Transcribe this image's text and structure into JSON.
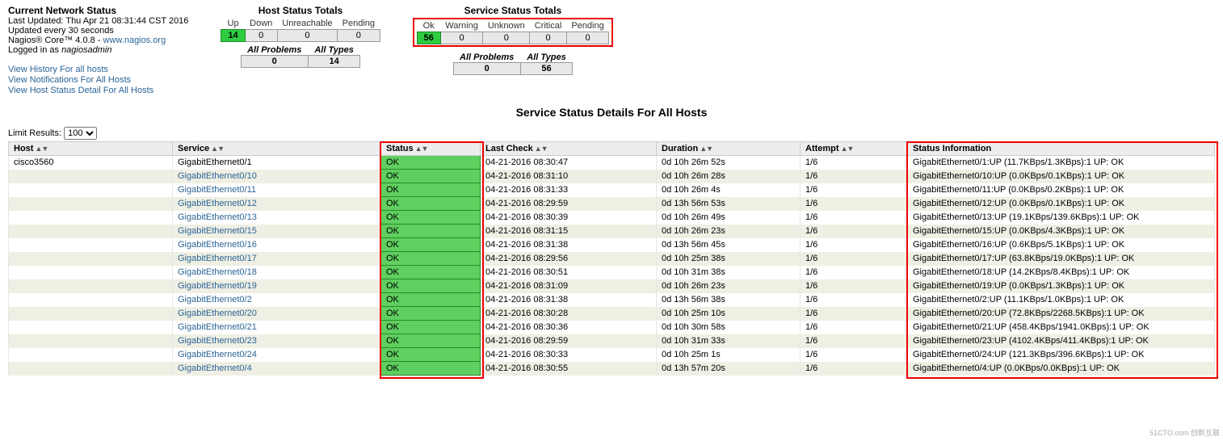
{
  "header": {
    "net_status_title": "Current Network Status",
    "last_updated": "Last Updated: Thu Apr 21 08:31:44 CST 2016",
    "update_interval": "Updated every 30 seconds",
    "product": "Nagios® Core™ 4.0.8 - ",
    "product_link": "www.nagios.org",
    "logged_in_prefix": "Logged in as ",
    "logged_in_user": "nagiosadmin",
    "links": {
      "history": "View History For all hosts",
      "notifications": "View Notifications For All Hosts",
      "host_detail": "View Host Status Detail For All Hosts"
    }
  },
  "host_totals": {
    "title": "Host Status Totals",
    "cols": [
      "Up",
      "Down",
      "Unreachable",
      "Pending"
    ],
    "vals": [
      "14",
      "0",
      "0",
      "0"
    ],
    "problems_label": "All Problems",
    "all_types_label": "All Types",
    "problems_val": "0",
    "all_types_val": "14"
  },
  "service_totals": {
    "title": "Service Status Totals",
    "cols": [
      "Ok",
      "Warning",
      "Unknown",
      "Critical",
      "Pending"
    ],
    "vals": [
      "56",
      "0",
      "0",
      "0",
      "0"
    ],
    "problems_label": "All Problems",
    "all_types_label": "All Types",
    "problems_val": "0",
    "all_types_val": "56"
  },
  "page_title": "Service Status Details For All Hosts",
  "limit": {
    "label": "Limit Results:",
    "value": "100"
  },
  "columns": {
    "host": "Host",
    "service": "Service",
    "status": "Status",
    "last_check": "Last Check",
    "duration": "Duration",
    "attempt": "Attempt",
    "status_info": "Status Information"
  },
  "host_name": "cisco3560",
  "rows": [
    {
      "service": "GigabitEthernet0/1",
      "status": "OK",
      "last_check": "04-21-2016 08:30:47",
      "duration": "0d 10h 26m 52s",
      "attempt": "1/6",
      "info": "GigabitEthernet0/1:UP (11.7KBps/1.3KBps):1 UP: OK",
      "link": false
    },
    {
      "service": "GigabitEthernet0/10",
      "status": "OK",
      "last_check": "04-21-2016 08:31:10",
      "duration": "0d 10h 26m 28s",
      "attempt": "1/6",
      "info": "GigabitEthernet0/10:UP (0.0KBps/0.1KBps):1 UP: OK",
      "link": true
    },
    {
      "service": "GigabitEthernet0/11",
      "status": "OK",
      "last_check": "04-21-2016 08:31:33",
      "duration": "0d 10h 26m 4s",
      "attempt": "1/6",
      "info": "GigabitEthernet0/11:UP (0.0KBps/0.2KBps):1 UP: OK",
      "link": true
    },
    {
      "service": "GigabitEthernet0/12",
      "status": "OK",
      "last_check": "04-21-2016 08:29:59",
      "duration": "0d 13h 56m 53s",
      "attempt": "1/6",
      "info": "GigabitEthernet0/12:UP (0.0KBps/0.1KBps):1 UP: OK",
      "link": true
    },
    {
      "service": "GigabitEthernet0/13",
      "status": "OK",
      "last_check": "04-21-2016 08:30:39",
      "duration": "0d 10h 26m 49s",
      "attempt": "1/6",
      "info": "GigabitEthernet0/13:UP (19.1KBps/139.6KBps):1 UP: OK",
      "link": true
    },
    {
      "service": "GigabitEthernet0/15",
      "status": "OK",
      "last_check": "04-21-2016 08:31:15",
      "duration": "0d 10h 26m 23s",
      "attempt": "1/6",
      "info": "GigabitEthernet0/15:UP (0.0KBps/4.3KBps):1 UP: OK",
      "link": true
    },
    {
      "service": "GigabitEthernet0/16",
      "status": "OK",
      "last_check": "04-21-2016 08:31:38",
      "duration": "0d 13h 56m 45s",
      "attempt": "1/6",
      "info": "GigabitEthernet0/16:UP (0.6KBps/5.1KBps):1 UP: OK",
      "link": true
    },
    {
      "service": "GigabitEthernet0/17",
      "status": "OK",
      "last_check": "04-21-2016 08:29:56",
      "duration": "0d 10h 25m 38s",
      "attempt": "1/6",
      "info": "GigabitEthernet0/17:UP (63.8KBps/19.0KBps):1 UP: OK",
      "link": true
    },
    {
      "service": "GigabitEthernet0/18",
      "status": "OK",
      "last_check": "04-21-2016 08:30:51",
      "duration": "0d 10h 31m 38s",
      "attempt": "1/6",
      "info": "GigabitEthernet0/18:UP (14.2KBps/8.4KBps):1 UP: OK",
      "link": true
    },
    {
      "service": "GigabitEthernet0/19",
      "status": "OK",
      "last_check": "04-21-2016 08:31:09",
      "duration": "0d 10h 26m 23s",
      "attempt": "1/6",
      "info": "GigabitEthernet0/19:UP (0.0KBps/1.3KBps):1 UP: OK",
      "link": true
    },
    {
      "service": "GigabitEthernet0/2",
      "status": "OK",
      "last_check": "04-21-2016 08:31:38",
      "duration": "0d 13h 56m 38s",
      "attempt": "1/6",
      "info": "GigabitEthernet0/2:UP (11.1KBps/1.0KBps):1 UP: OK",
      "link": true
    },
    {
      "service": "GigabitEthernet0/20",
      "status": "OK",
      "last_check": "04-21-2016 08:30:28",
      "duration": "0d 10h 25m 10s",
      "attempt": "1/6",
      "info": "GigabitEthernet0/20:UP (72.8KBps/2268.5KBps):1 UP: OK",
      "link": true
    },
    {
      "service": "GigabitEthernet0/21",
      "status": "OK",
      "last_check": "04-21-2016 08:30:36",
      "duration": "0d 10h 30m 58s",
      "attempt": "1/6",
      "info": "GigabitEthernet0/21:UP (458.4KBps/1941.0KBps):1 UP: OK",
      "link": true
    },
    {
      "service": "GigabitEthernet0/23",
      "status": "OK",
      "last_check": "04-21-2016 08:29:59",
      "duration": "0d 10h 31m 33s",
      "attempt": "1/6",
      "info": "GigabitEthernet0/23:UP (4102.4KBps/411.4KBps):1 UP: OK",
      "link": true
    },
    {
      "service": "GigabitEthernet0/24",
      "status": "OK",
      "last_check": "04-21-2016 08:30:33",
      "duration": "0d 10h 25m 1s",
      "attempt": "1/6",
      "info": "GigabitEthernet0/24:UP (121.3KBps/396.6KBps):1 UP: OK",
      "link": true
    },
    {
      "service": "GigabitEthernet0/4",
      "status": "OK",
      "last_check": "04-21-2016 08:30:55",
      "duration": "0d 13h 57m 20s",
      "attempt": "1/6",
      "info": "GigabitEthernet0/4:UP (0.0KBps/0.0KBps):1 UP: OK",
      "link": true
    }
  ],
  "watermark": "51CTO.com 创新互联"
}
